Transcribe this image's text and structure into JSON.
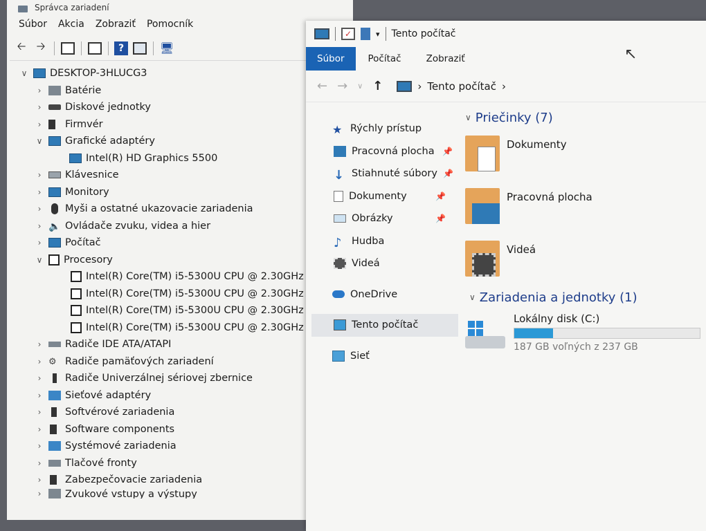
{
  "device_manager": {
    "title": "Správca zariadení",
    "menu": [
      "Súbor",
      "Akcia",
      "Zobraziť",
      "Pomocník"
    ],
    "toolbar_icons": [
      "back-arrow-icon",
      "forward-arrow-icon",
      "properties-icon",
      "show-hidden-icon",
      "help-icon",
      "update-driver-icon",
      "scan-hardware-icon"
    ],
    "root": "DESKTOP-3HLUCG3",
    "categories": [
      {
        "label": "Batérie",
        "expanded": false
      },
      {
        "label": "Diskové jednotky",
        "expanded": false
      },
      {
        "label": "Firmvér",
        "expanded": false
      },
      {
        "label": "Grafické adaptéry",
        "expanded": true,
        "children": [
          "Intel(R) HD Graphics 5500"
        ]
      },
      {
        "label": "Klávesnice",
        "expanded": false
      },
      {
        "label": "Monitory",
        "expanded": false
      },
      {
        "label": "Myši a ostatné ukazovacie zariadenia",
        "expanded": false
      },
      {
        "label": "Ovládače zvuku, videa a hier",
        "expanded": false
      },
      {
        "label": "Počítač",
        "expanded": false
      },
      {
        "label": "Procesory",
        "expanded": true,
        "children": [
          "Intel(R) Core(TM) i5-5300U CPU @ 2.30GHz",
          "Intel(R) Core(TM) i5-5300U CPU @ 2.30GHz",
          "Intel(R) Core(TM) i5-5300U CPU @ 2.30GHz",
          "Intel(R) Core(TM) i5-5300U CPU @ 2.30GHz"
        ]
      },
      {
        "label": "Radiče IDE ATA/ATAPI",
        "expanded": false
      },
      {
        "label": "Radiče pamäťových zariadení",
        "expanded": false
      },
      {
        "label": "Radiče Univerzálnej sériovej zbernice",
        "expanded": false
      },
      {
        "label": "Sieťové adaptéry",
        "expanded": false
      },
      {
        "label": "Softvérové zariadenia",
        "expanded": false
      },
      {
        "label": "Software components",
        "expanded": false
      },
      {
        "label": "Systémové zariadenia",
        "expanded": false
      },
      {
        "label": "Tlačové fronty",
        "expanded": false
      },
      {
        "label": "Zabezpečovacie zariadenia",
        "expanded": false
      },
      {
        "label": "Zvukové vstupy a výstupy",
        "expanded": false
      }
    ]
  },
  "explorer": {
    "title": "Tento počítač",
    "ribbon_tabs": [
      "Súbor",
      "Počítač",
      "Zobraziť"
    ],
    "breadcrumb": [
      "Tento počítač"
    ],
    "nav": {
      "quick_access": "Rýchly prístup",
      "pinned": [
        "Pracovná plocha",
        "Stiahnuté súbory",
        "Dokumenty",
        "Obrázky"
      ],
      "unpinned": [
        "Hudba",
        "Videá"
      ],
      "onedrive": "OneDrive",
      "this_pc": "Tento počítač",
      "network": "Sieť"
    },
    "folders_header": "Priečinky (7)",
    "folders": [
      "Dokumenty",
      "Pracovná plocha",
      "Videá"
    ],
    "devices_header": "Zariadenia a jednotky (1)",
    "drive": {
      "name": "Lokálny disk (C:)",
      "free_text": "187 GB voľných z 237 GB",
      "used_fraction": 0.21,
      "fill_color": "#2b99d6"
    }
  }
}
